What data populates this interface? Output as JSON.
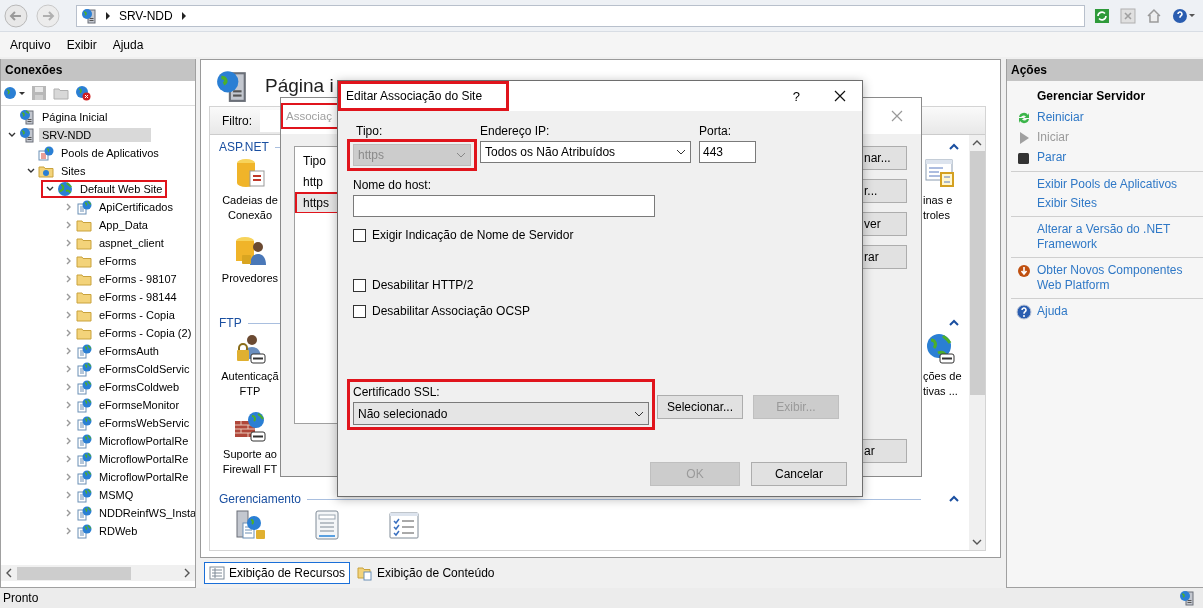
{
  "address_bar": {
    "path": [
      "SRV-NDD"
    ]
  },
  "menu": [
    "Arquivo",
    "Exibir",
    "Ajuda"
  ],
  "connections": {
    "title": "Conexões",
    "tree": [
      {
        "label": "Página Inicial",
        "kind": "start-page",
        "selected": false,
        "highlighted": false
      },
      {
        "label": "SRV-NDD",
        "kind": "server",
        "selected": true,
        "highlighted": false,
        "expanded": true,
        "children": [
          {
            "label": "Pools de Aplicativos",
            "kind": "app-pools",
            "selected": false,
            "highlighted": false
          },
          {
            "label": "Sites",
            "kind": "sites",
            "selected": false,
            "highlighted": false,
            "expanded": true,
            "children": [
              {
                "label": "Default Web Site",
                "kind": "site",
                "selected": false,
                "highlighted": true,
                "expanded": true,
                "children": [
                  {
                    "label": "ApiCertificados",
                    "kind": "app",
                    "selected": false,
                    "highlighted": false,
                    "expanded": false
                  },
                  {
                    "label": "App_Data",
                    "kind": "folder",
                    "selected": false,
                    "highlighted": false,
                    "expanded": false
                  },
                  {
                    "label": "aspnet_client",
                    "kind": "folder",
                    "selected": false,
                    "highlighted": false,
                    "expanded": false
                  },
                  {
                    "label": "eForms",
                    "kind": "folder",
                    "selected": false,
                    "highlighted": false,
                    "expanded": false
                  },
                  {
                    "label": "eForms - 98107",
                    "kind": "folder",
                    "selected": false,
                    "highlighted": false,
                    "expanded": false
                  },
                  {
                    "label": "eForms - 98144",
                    "kind": "folder",
                    "selected": false,
                    "highlighted": false,
                    "expanded": false
                  },
                  {
                    "label": "eForms - Copia",
                    "kind": "folder",
                    "selected": false,
                    "highlighted": false,
                    "expanded": false
                  },
                  {
                    "label": "eForms - Copia (2)",
                    "kind": "folder",
                    "selected": false,
                    "highlighted": false,
                    "expanded": false
                  },
                  {
                    "label": "eFormsAuth",
                    "kind": "app",
                    "selected": false,
                    "highlighted": false,
                    "expanded": false
                  },
                  {
                    "label": "eFormsColdServic",
                    "kind": "app",
                    "selected": false,
                    "highlighted": false,
                    "expanded": false
                  },
                  {
                    "label": "eFormsColdweb",
                    "kind": "app",
                    "selected": false,
                    "highlighted": false,
                    "expanded": false
                  },
                  {
                    "label": "eFormseMonitor",
                    "kind": "app",
                    "selected": false,
                    "highlighted": false,
                    "expanded": false
                  },
                  {
                    "label": "eFormsWebServic",
                    "kind": "app",
                    "selected": false,
                    "highlighted": false,
                    "expanded": false
                  },
                  {
                    "label": "MicroflowPortalRe",
                    "kind": "app",
                    "selected": false,
                    "highlighted": false,
                    "expanded": false
                  },
                  {
                    "label": "MicroflowPortalRe",
                    "kind": "app",
                    "selected": false,
                    "highlighted": false,
                    "expanded": false
                  },
                  {
                    "label": "MicroflowPortalRe",
                    "kind": "app",
                    "selected": false,
                    "highlighted": false,
                    "expanded": false
                  },
                  {
                    "label": "MSMQ",
                    "kind": "app",
                    "selected": false,
                    "highlighted": false,
                    "expanded": false
                  },
                  {
                    "label": "NDDReinfWS_Insta",
                    "kind": "app",
                    "selected": false,
                    "highlighted": false,
                    "expanded": false
                  },
                  {
                    "label": "RDWeb",
                    "kind": "app",
                    "selected": false,
                    "highlighted": false,
                    "expanded": false
                  }
                ]
              }
            ]
          }
        ]
      }
    ]
  },
  "home": {
    "title": "Página i",
    "filter_label": "Filtro:",
    "groups": [
      {
        "title": "ASP.NET",
        "rows": [
          {
            "items": [
              {
                "kind": "connection-strings",
                "lines": [
                  "Cadeias de",
                  "Conexão"
                ]
              }
            ],
            "last_item": {
              "kind": "pages",
              "lines": [
                "inas e",
                "troles"
              ]
            }
          },
          {
            "items": [
              {
                "kind": "providers",
                "lines": [
                  "Provedores"
                ]
              }
            ]
          }
        ]
      },
      {
        "title": "FTP",
        "rows": [
          {
            "items": [
              {
                "kind": "ftp-auth",
                "lines": [
                  "Autenticaçã",
                  "FTP"
                ]
              }
            ],
            "last_item": {
              "kind": "ftp-globe",
              "lines": [
                "ções de",
                "tivas ..."
              ]
            }
          },
          {
            "items": [
              {
                "kind": "ftp-firewall",
                "lines": [
                  "Suporte ao",
                  "Firewall FT"
                ]
              }
            ]
          }
        ]
      },
      {
        "title": "Gerenciamento",
        "rows": [
          {
            "items": [
              {
                "kind": "server-cert"
              },
              {
                "kind": "config"
              },
              {
                "kind": "checklist"
              }
            ]
          }
        ]
      }
    ]
  },
  "view_tabs": [
    {
      "label": "Exibição de Recursos",
      "kind": "features",
      "selected": true
    },
    {
      "label": "Exibição de Conteúdo",
      "kind": "content",
      "selected": false
    }
  ],
  "actions": {
    "title": "Ações",
    "heading": "Gerenciar Servidor",
    "sections": [
      {
        "items": [
          {
            "label": "Reiniciar",
            "kind": "restart",
            "disabled": false
          },
          {
            "label": "Iniciar",
            "kind": "start",
            "disabled": true
          },
          {
            "label": "Parar",
            "kind": "stop",
            "disabled": false
          }
        ]
      },
      {
        "items": [
          {
            "label": "Exibir Pools de Aplicativos",
            "kind": "link",
            "disabled": false
          },
          {
            "label": "Exibir Sites",
            "kind": "link",
            "disabled": false
          }
        ]
      },
      {
        "items": [
          {
            "label": "Alterar a Versão do .NET Framework",
            "kind": "link",
            "disabled": false
          }
        ]
      },
      {
        "items": [
          {
            "label": "Obter Novos Componentes Web Platform",
            "kind": "download",
            "disabled": false
          }
        ]
      },
      {
        "items": [
          {
            "label": "Ajuda",
            "kind": "help",
            "disabled": false
          }
        ]
      }
    ]
  },
  "bindings_dialog": {
    "title": "Associaç",
    "highlighted": true,
    "column": "Tipo",
    "rows": [
      {
        "type": "http",
        "selected": false,
        "highlighted": false
      },
      {
        "type": "https",
        "selected": true,
        "highlighted": true
      }
    ],
    "buttons": [
      "nar...",
      "r...",
      "ver",
      "rar",
      "ar"
    ]
  },
  "edit_dialog": {
    "title": "Editar Associação do Site",
    "highlighted": true,
    "help_label": "?",
    "type": {
      "label": "Tipo:",
      "value": "https",
      "disabled": true,
      "highlighted": true
    },
    "ip": {
      "label": "Endereço IP:",
      "value": "Todos os Não Atribuídos"
    },
    "port": {
      "label": "Porta:",
      "value": "443"
    },
    "host": {
      "label": "Nome do host:"
    },
    "sni": {
      "label": "Exigir Indicação de Nome de Servidor",
      "checked": false
    },
    "options": [
      {
        "label": "Desabilitar HTTP/2",
        "checked": false
      },
      {
        "label": "Desabilitar Associação OCSP",
        "checked": false
      }
    ],
    "ssl": {
      "label": "Certificado SSL:",
      "value": "Não selecionado",
      "highlighted": true
    },
    "ssl_buttons": [
      {
        "label": "Selecionar...",
        "disabled": false
      },
      {
        "label": "Exibir...",
        "disabled": true
      }
    ],
    "buttons": [
      {
        "label": "OK",
        "disabled": true
      },
      {
        "label": "Cancelar",
        "disabled": false
      }
    ]
  },
  "status_bar": {
    "text": "Pronto"
  }
}
